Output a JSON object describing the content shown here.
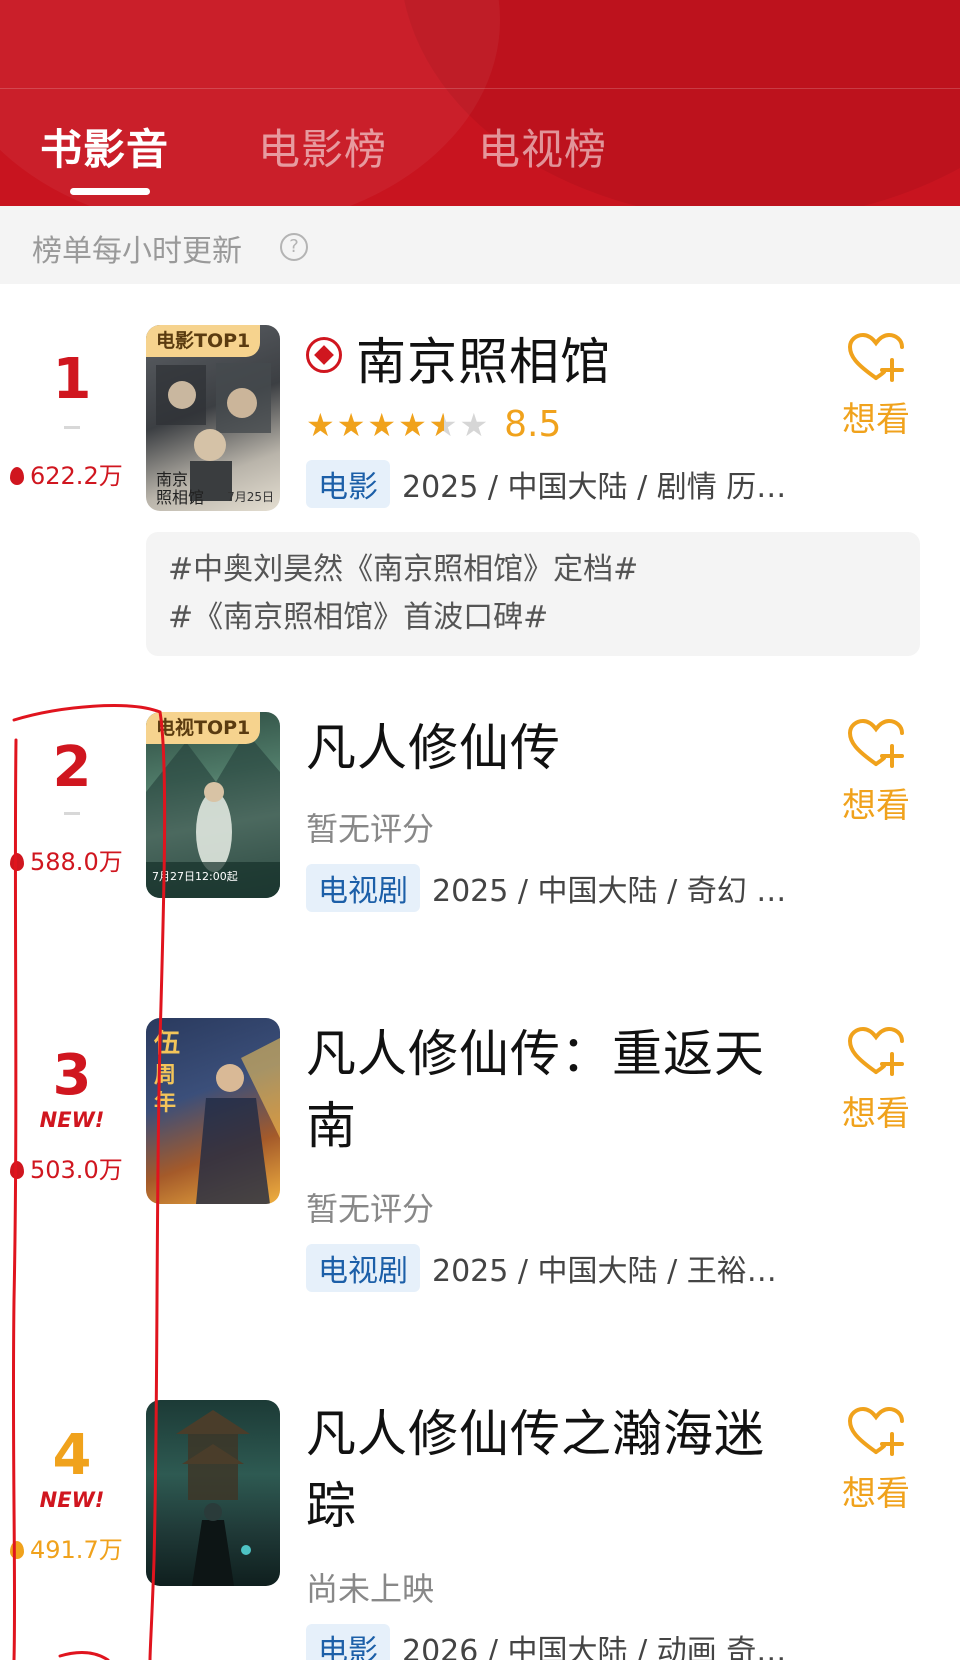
{
  "colors": {
    "brand_red": "#c8141f",
    "orange": "#f0a21c",
    "rank_gold": "#f0a21c",
    "tag_blue": "#1c5fa8"
  },
  "tabs": [
    {
      "label": "书影音",
      "active": true
    },
    {
      "label": "电影榜",
      "active": false
    },
    {
      "label": "电视榜",
      "active": false
    }
  ],
  "subheader": {
    "text": "榜单每小时更新",
    "icon": "help-icon"
  },
  "items": [
    {
      "rank": "1",
      "heat": "622.2万",
      "poster_badge": "电影TOP1",
      "poster_date": "7月25日",
      "title": "南京照相馆",
      "title_icon": "ticket-icon",
      "rating": 4.5,
      "score": "8.5",
      "type": "电影",
      "meta": "2025 / 中国大陆 / 剧情 历…",
      "want_label": "想看",
      "hashtags": [
        "#中奥刘昊然《南京照相馆》定档#",
        "#《南京照相馆》首波口碑#"
      ]
    },
    {
      "rank": "2",
      "heat": "588.0万",
      "poster_badge": "电视TOP1",
      "title": "凡人修仙传",
      "rating_text": "暂无评分",
      "type": "电视剧",
      "meta": "2025 / 中国大陆 / 奇幻 …",
      "want_label": "想看"
    },
    {
      "rank": "3",
      "new_badge": "NEW!",
      "heat": "503.0万",
      "title_line1": "凡人修仙传：重返天",
      "title_line2": "南",
      "rating_text": "暂无评分",
      "type": "电视剧",
      "meta": "2025 / 中国大陆 / 王裕…",
      "want_label": "想看"
    },
    {
      "rank": "4",
      "new_badge": "NEW!",
      "heat": "491.7万",
      "title_line1": "凡人修仙传之瀚海迷",
      "title_line2": "踪",
      "rating_text": "尚未上映",
      "type": "电影",
      "meta": "2026 / 中国大陆 / 动画 奇…",
      "want_label": "想看"
    }
  ]
}
